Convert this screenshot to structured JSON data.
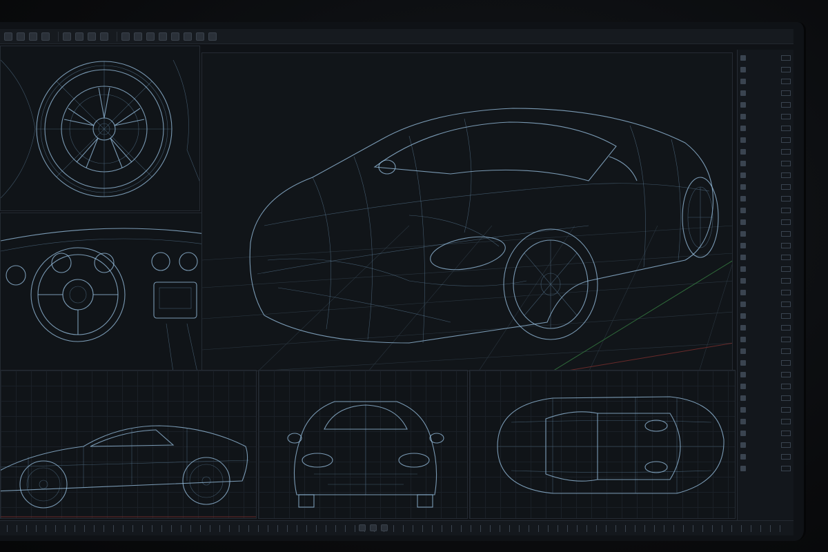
{
  "toolbar": {
    "icons": [
      "file-icon",
      "save-icon",
      "undo-icon",
      "redo-icon",
      "move-icon",
      "rotate-icon",
      "scale-icon",
      "select-icon",
      "camera-icon",
      "light-icon",
      "render-icon",
      "grid-icon",
      "snap-icon",
      "mesh-icon",
      "material-icon",
      "settings-icon"
    ]
  },
  "panes": [
    {
      "id": "wheel-detail",
      "view": "wheel"
    },
    {
      "id": "interior-detail",
      "view": "interior"
    },
    {
      "id": "perspective",
      "view": "perspective"
    },
    {
      "id": "side",
      "view": "side"
    },
    {
      "id": "front",
      "view": "front"
    },
    {
      "id": "top",
      "view": "top"
    }
  ],
  "colors": {
    "wire": "#9ec7e8",
    "axis_x": "#b23a3a",
    "axis_y": "#3aa34a",
    "background": "#0f1216"
  }
}
